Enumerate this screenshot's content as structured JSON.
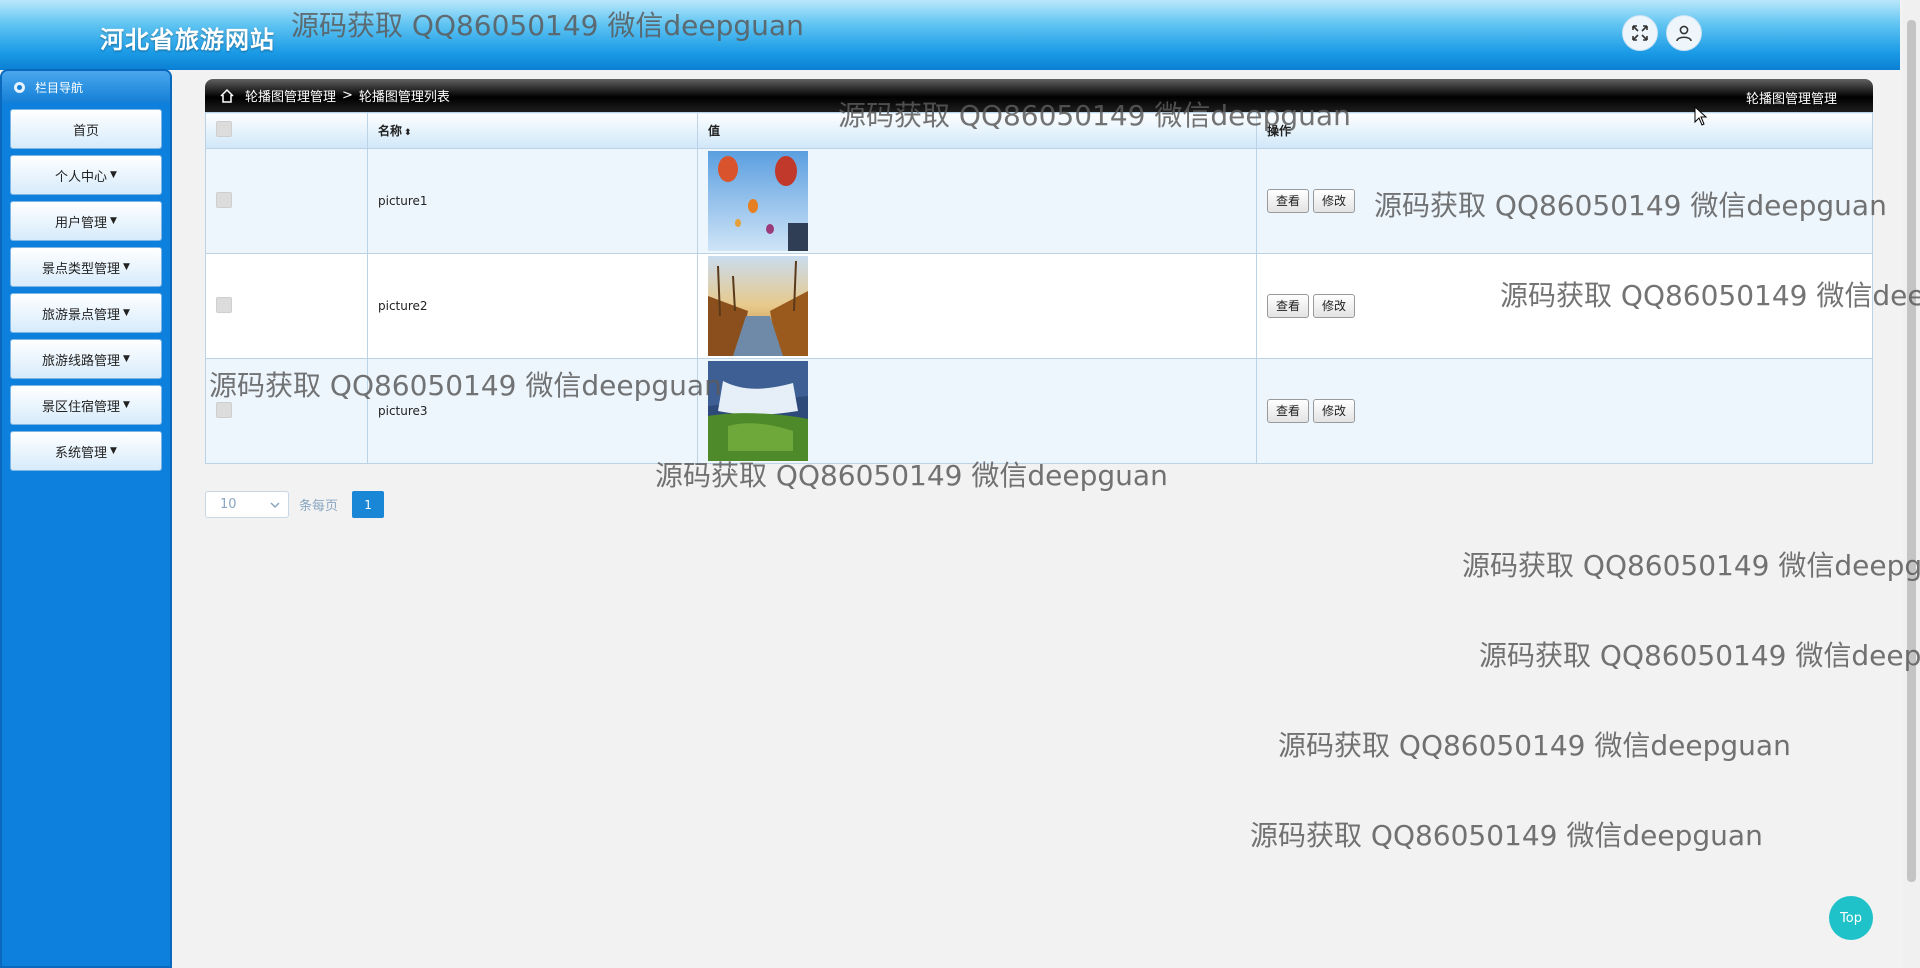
{
  "header": {
    "site_title": "河北省旅游网站"
  },
  "sidebar": {
    "heading": "栏目导航",
    "items": [
      {
        "label": "首页",
        "caret": ""
      },
      {
        "label": "个人中心",
        "caret": "▼"
      },
      {
        "label": "用户管理",
        "caret": "▼"
      },
      {
        "label": "景点类型管理",
        "caret": "▼"
      },
      {
        "label": "旅游景点管理",
        "caret": "▼"
      },
      {
        "label": "旅游线路管理",
        "caret": "▼"
      },
      {
        "label": "景区住宿管理",
        "caret": "▼"
      },
      {
        "label": "系统管理",
        "caret": "▼"
      }
    ]
  },
  "breadcrumb": {
    "parent": "轮播图管理管理",
    "separator": ">",
    "current": "轮播图管理列表",
    "right_title": "轮播图管理管理"
  },
  "table": {
    "headers": {
      "name": "名称",
      "sort_icon": "⬍",
      "value": "值",
      "actions": "操作"
    },
    "rows": [
      {
        "name": "picture1",
        "image": "hot-air-balloons"
      },
      {
        "name": "picture2",
        "image": "autumn-river"
      },
      {
        "name": "picture3",
        "image": "waterfall"
      }
    ],
    "view_label": "查看",
    "edit_label": "修改"
  },
  "pager": {
    "page_size": "10",
    "per_page_label": "条每页",
    "current_page": "1"
  },
  "watermark": "源码获取 QQ86050149 微信deepguan",
  "top_button": "Top",
  "colors": {
    "header": "#1b9be6",
    "sidebar": "#0d80de",
    "accent": "#1a86d6",
    "top_button": "#1fc2c8"
  }
}
